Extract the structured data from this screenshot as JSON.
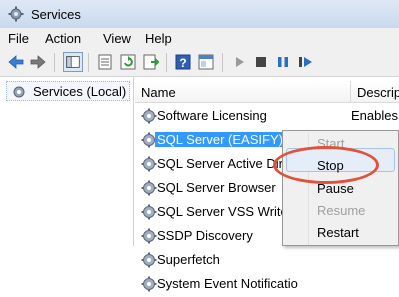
{
  "window": {
    "title": "Services",
    "icon": "services-gear-icon"
  },
  "menu": [
    "File",
    "Action",
    "View",
    "Help"
  ],
  "toolbar": {
    "icons": [
      "back-arrow-icon",
      "forward-arrow-icon",
      "console-tree-icon",
      "properties-icon",
      "refresh-icon",
      "export-list-icon",
      "help-icon",
      "show-hide-icon",
      "start-service-icon",
      "stop-service-icon",
      "pause-service-icon",
      "restart-service-icon"
    ]
  },
  "tree": {
    "label": "Services (Local)"
  },
  "columns": {
    "name": "Name",
    "description": "Descriptio"
  },
  "rows": [
    {
      "name": "Software Licensing",
      "desc": "Enables t"
    },
    {
      "name": "SQL Server (EASIFY)",
      "desc": ""
    },
    {
      "name": "SQL Server Active Direc",
      "desc": ""
    },
    {
      "name": "SQL Server Browser",
      "desc": ""
    },
    {
      "name": "SQL Server VSS Writer",
      "desc": ""
    },
    {
      "name": "SSDP Discovery",
      "desc": ""
    },
    {
      "name": "Superfetch",
      "desc": ""
    },
    {
      "name": "System Event Notificatio",
      "desc": ""
    }
  ],
  "context_menu": {
    "items": [
      {
        "label": "Start",
        "enabled": false
      },
      {
        "label": "Stop",
        "enabled": true
      },
      {
        "label": "Pause",
        "enabled": true
      },
      {
        "label": "Resume",
        "enabled": false
      },
      {
        "label": "Restart",
        "enabled": true
      }
    ]
  },
  "colors": {
    "highlight": "#3399ff",
    "annotation": "#e0533a"
  }
}
